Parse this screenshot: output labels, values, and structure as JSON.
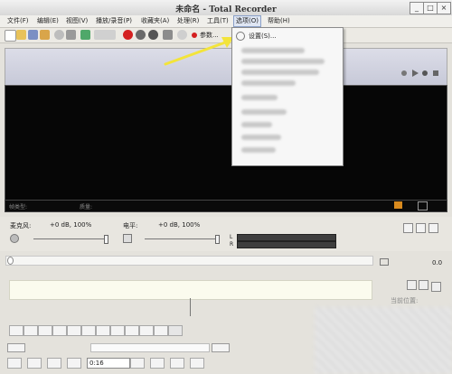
{
  "window": {
    "title": "未命名 - Total Recorder"
  },
  "menu": {
    "items": [
      {
        "label": "文件(F)"
      },
      {
        "label": "编辑(E)"
      },
      {
        "label": "视图(V)"
      },
      {
        "label": "播放/录音(P)"
      },
      {
        "label": "收藏夹(A)"
      },
      {
        "label": "处理(R)"
      },
      {
        "label": "工具(T)"
      },
      {
        "label": "选项(O)"
      },
      {
        "label": "帮助(H)"
      }
    ],
    "active_index": 7
  },
  "toolbar": {
    "params_label": "参数..."
  },
  "options_menu": {
    "first_item": "设置(S)..."
  },
  "status": {
    "type_label": "帧类型:",
    "quality_label": "质量:"
  },
  "recording": {
    "label": "麦克风:",
    "level": "+0 dB, 100%",
    "level_fraction": 1.0
  },
  "playback": {
    "label": "电平:",
    "level": "+0 dB, 100%",
    "level_fraction": 1.0
  },
  "meters": {
    "left": "L",
    "right": "R"
  },
  "position": {
    "time": "0.0",
    "time_field": "0:16",
    "position_label": "当前位置:"
  },
  "colors": {
    "screen": "#060606",
    "arrow": "#f3e43a",
    "banner": "#cfd1de"
  }
}
